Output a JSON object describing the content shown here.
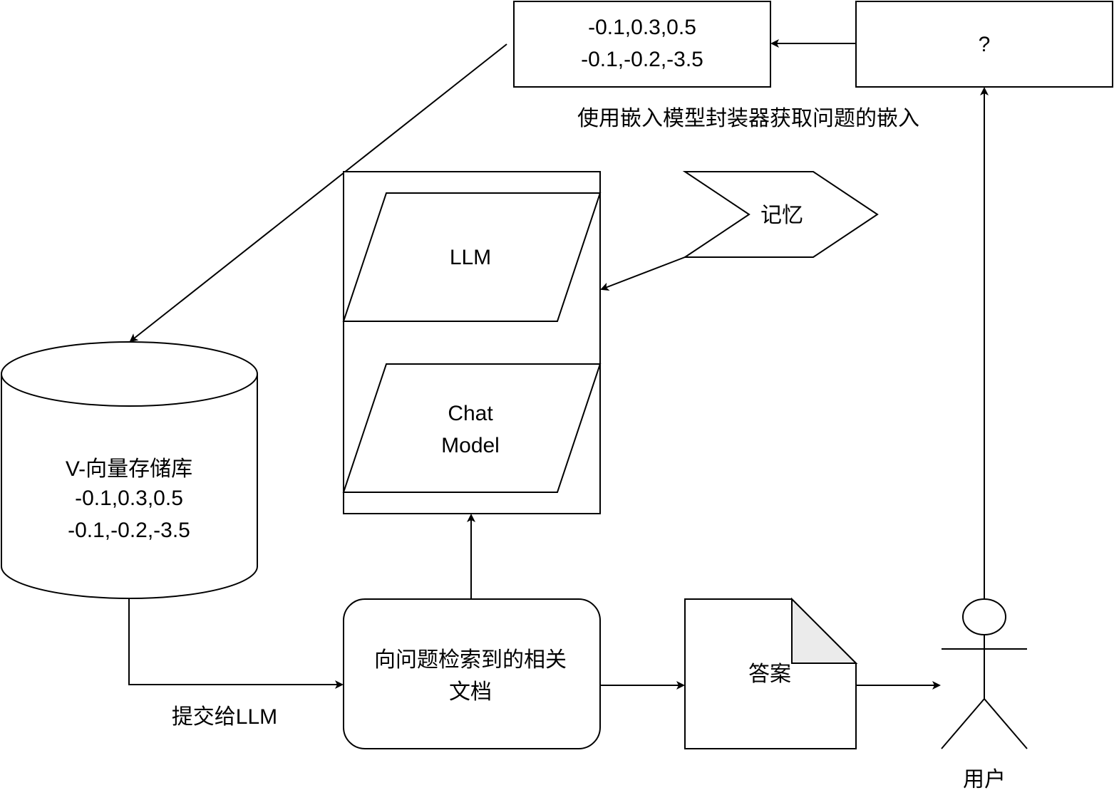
{
  "embedding_box": {
    "line1": "-0.1,0.3,0.5",
    "line2": "-0.1,-0.2,-3.5"
  },
  "question_box": {
    "label": "?"
  },
  "embedding_caption": "使用嵌入模型封装器获取问题的嵌入",
  "models": {
    "llm": "LLM",
    "chat_line1": "Chat",
    "chat_line2": "Model"
  },
  "memory": {
    "label": "记忆"
  },
  "vector_store": {
    "line1": "V-向量存储库",
    "line2": "-0.1,0.3,0.5",
    "line3": "-0.1,-0.2,-3.5"
  },
  "submit_label": "提交给LLM",
  "retrieved_docs": {
    "line1": "向问题检索到的相关",
    "line2": "文档"
  },
  "answer": {
    "label": "答案"
  },
  "user": {
    "label": "用户"
  }
}
